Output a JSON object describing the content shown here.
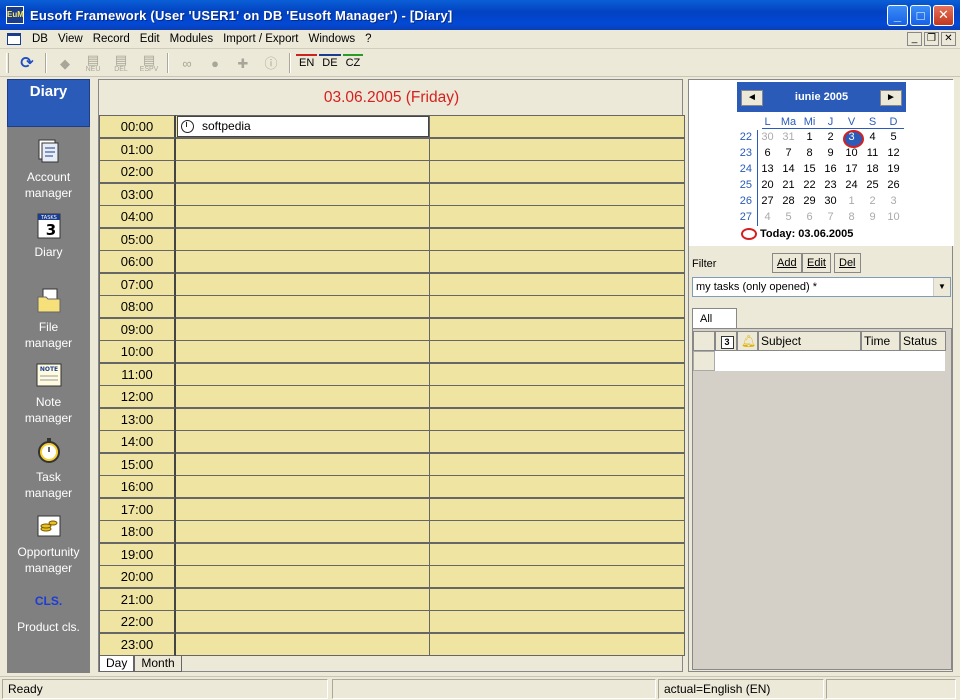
{
  "window": {
    "title": "Eusoft Framework (User 'USER1' on DB 'Eusoft Manager') - [Diary]",
    "icon_text": "EuM"
  },
  "menu": [
    "DB",
    "View",
    "Record",
    "Edit",
    "Modules",
    "Import / Export",
    "Windows",
    "?"
  ],
  "toolbar": {
    "buttons": [
      {
        "icon": "refresh-icon",
        "label": ""
      },
      {
        "icon": "tag-icon",
        "label": ""
      },
      {
        "icon": "new-icon",
        "label": "NEU"
      },
      {
        "icon": "delete-icon",
        "label": "DEL"
      },
      {
        "icon": "copy-icon",
        "label": "ESPV"
      },
      {
        "icon": "binoculars-icon",
        "label": ""
      },
      {
        "icon": "lock-icon",
        "label": ""
      },
      {
        "icon": "puzzle-icon",
        "label": ""
      },
      {
        "icon": "info-icon",
        "label": ""
      }
    ],
    "languages": [
      "EN",
      "DE",
      "CZ"
    ]
  },
  "sidebar": {
    "header": "Diary",
    "items": [
      {
        "label": "Account\nmanager",
        "icon": "account-manager-icon"
      },
      {
        "label": "Diary",
        "icon": "diary-icon"
      },
      {
        "label": "File\nmanager",
        "icon": "folder-icon"
      },
      {
        "label": "Note\nmanager",
        "icon": "note-icon"
      },
      {
        "label": "Task\nmanager",
        "icon": "stopwatch-icon"
      },
      {
        "label": "Opportunity\nmanager",
        "icon": "opportunity-icon"
      },
      {
        "label": "Product cls.",
        "icon": "product-cls-icon"
      }
    ],
    "diary_icon_text": "TASKS",
    "diary_icon_num": "3",
    "note_icon_text": "NOTE",
    "cls_icon_text": "CLS."
  },
  "diary": {
    "date_heading": "03.06.2005 (Friday)",
    "hours": [
      "00:00",
      "01:00",
      "02:00",
      "03:00",
      "04:00",
      "05:00",
      "06:00",
      "07:00",
      "08:00",
      "09:00",
      "10:00",
      "11:00",
      "12:00",
      "13:00",
      "14:00",
      "15:00",
      "16:00",
      "17:00",
      "18:00",
      "19:00",
      "20:00",
      "21:00",
      "22:00",
      "23:00"
    ],
    "event": {
      "hour": "00:00",
      "text": "softpedia"
    },
    "tabs": [
      "Day",
      "Month"
    ],
    "active_tab": "Day"
  },
  "calendar": {
    "month_label": "iunie 2005",
    "prev": "◄",
    "next": "►",
    "dow": [
      "L",
      "Ma",
      "Mi",
      "J",
      "V",
      "S",
      "D"
    ],
    "weeks": [
      {
        "no": "22",
        "days": [
          "30",
          "31",
          "1",
          "2",
          "3",
          "4",
          "5"
        ],
        "muted": [
          true,
          true,
          false,
          false,
          false,
          false,
          false
        ]
      },
      {
        "no": "23",
        "days": [
          "6",
          "7",
          "8",
          "9",
          "10",
          "11",
          "12"
        ],
        "muted": [
          false,
          false,
          false,
          false,
          false,
          false,
          false
        ]
      },
      {
        "no": "24",
        "days": [
          "13",
          "14",
          "15",
          "16",
          "17",
          "18",
          "19"
        ],
        "muted": [
          false,
          false,
          false,
          false,
          false,
          false,
          false
        ]
      },
      {
        "no": "25",
        "days": [
          "20",
          "21",
          "22",
          "23",
          "24",
          "25",
          "26"
        ],
        "muted": [
          false,
          false,
          false,
          false,
          false,
          false,
          false
        ]
      },
      {
        "no": "26",
        "days": [
          "27",
          "28",
          "29",
          "30",
          "1",
          "2",
          "3"
        ],
        "muted": [
          false,
          false,
          false,
          false,
          true,
          true,
          true
        ]
      },
      {
        "no": "27",
        "days": [
          "4",
          "5",
          "6",
          "7",
          "8",
          "9",
          "10"
        ],
        "muted": [
          true,
          true,
          true,
          true,
          true,
          true,
          true
        ]
      }
    ],
    "selected_day": "3",
    "today_label": "Today: 03.06.2005"
  },
  "filter": {
    "label": "Filter",
    "buttons": [
      "Add",
      "Edit",
      "Del"
    ],
    "value": "my tasks (only opened) *"
  },
  "tasks": {
    "tab": "All",
    "columns": [
      "",
      "",
      "",
      "Subject",
      "Time",
      "Status"
    ]
  },
  "status": {
    "left": "Ready",
    "middle": "",
    "lang": "actual=English (EN)",
    "right": ""
  },
  "colors": {
    "title_bar": "#0242c2",
    "sidebar_header": "#2a5bb8",
    "sidebar_bg": "#808080",
    "diary_cell": "#efe4a1",
    "date_red": "#d62020",
    "calendar_blue": "#2a5bb8"
  }
}
